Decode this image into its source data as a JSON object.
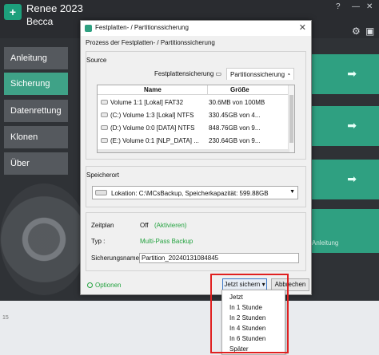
{
  "app": {
    "logo_glyph": "+",
    "title": "Renee 2023",
    "subtitle": "Becca",
    "window_buttons": [
      "?",
      "—",
      "✕"
    ],
    "nav": [
      {
        "label": "Anleitung"
      },
      {
        "label": "Sicherung",
        "active": true
      },
      {
        "label": "Datenrettung"
      },
      {
        "label": "Klonen"
      },
      {
        "label": "Über"
      }
    ],
    "background_label": "Anleitung",
    "footer_number": "15",
    "accent_color": "#2fa081"
  },
  "dialog": {
    "title": "Festplatten- / Partitionssicherung",
    "heading": "Prozess der Festplatten- / Partitionssicherung",
    "source": {
      "label": "Source",
      "tabs": [
        {
          "label": "Festplattensicherung"
        },
        {
          "label": "Partitionssicherung",
          "selected": true
        }
      ],
      "columns": [
        "Name",
        "Größe"
      ],
      "rows": [
        {
          "name": "Volume 1:1 [Lokal] FAT32",
          "size": "30.6MB von 100MB"
        },
        {
          "name": "(C:) Volume 1:3 [Lokal] NTFS",
          "size": "330.45GB von 4..."
        },
        {
          "name": "(D:) Volume 0:0 [DATA] NTFS",
          "size": "848.76GB von 9..."
        },
        {
          "name": "(E:) Volume 0:1 [NLP_DATA] ...",
          "size": "230.64GB von 9..."
        }
      ]
    },
    "speicherort": {
      "label": "Speicherort",
      "value": "Lokation: C:\\MCsBackup, Speicherkapazität: 599.88GB"
    },
    "zeitplan": {
      "label": "Zeitplan",
      "value": "Off",
      "link": "(Aktivieren)"
    },
    "typ": {
      "label": "Typ :",
      "value": "Multi-Pass Backup"
    },
    "sicherungsname": {
      "label": "Sicherungsname",
      "value": "Partition_20240131084845"
    },
    "options_label": "Optionen",
    "buttons": {
      "backup_now": "Jetzt sichern",
      "cancel": "Abbrechen"
    },
    "dropdown_items": [
      "Jetzt",
      "In 1 Stunde",
      "In 2 Stunden",
      "In 4 Stunden",
      "In 6 Stunden",
      "Später"
    ],
    "highlight_color": "#e02020"
  }
}
